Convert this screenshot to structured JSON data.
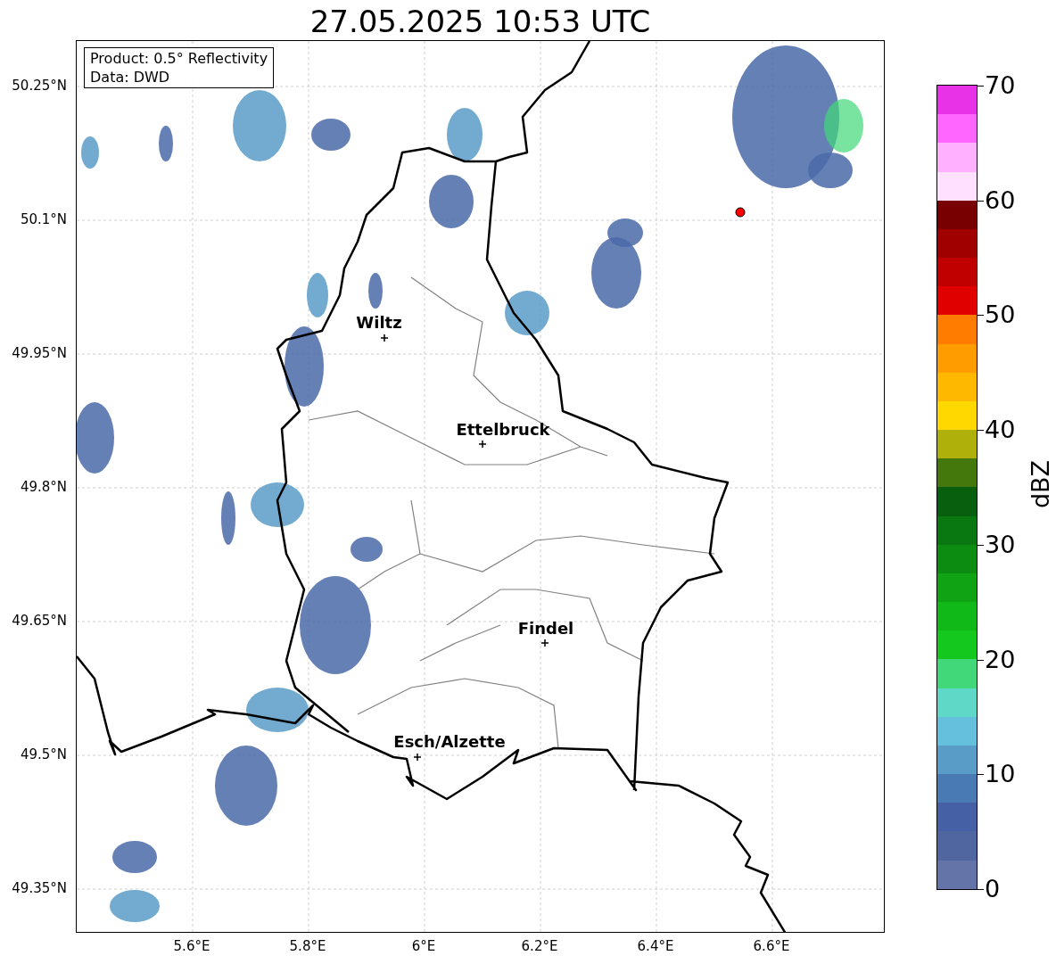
{
  "title": "27.05.2025 10:53 UTC",
  "info_box": [
    "Product: 0.5° Reflectivity",
    "Data: DWD"
  ],
  "x_ticks": [
    "5.6°E",
    "5.8°E",
    "6°E",
    "6.2°E",
    "6.4°E",
    "6.6°E"
  ],
  "y_ticks": [
    "50.25°N",
    "50.1°N",
    "49.95°N",
    "49.8°N",
    "49.65°N",
    "49.5°N",
    "49.35°N"
  ],
  "cities": [
    {
      "name": "Wiltz"
    },
    {
      "name": "Ettelbruck"
    },
    {
      "name": "Findel"
    },
    {
      "name": "Esch/Alzette"
    }
  ],
  "colorbar": {
    "label": "dBZ",
    "ticks": [
      "70",
      "60",
      "50",
      "40",
      "30",
      "20",
      "10",
      "0"
    ],
    "bands": [
      {
        "color": "#e832e8"
      },
      {
        "color": "#ff66ff"
      },
      {
        "color": "#ffb0ff"
      },
      {
        "color": "#ffe0ff"
      },
      {
        "color": "#780000"
      },
      {
        "color": "#a00000"
      },
      {
        "color": "#c00000"
      },
      {
        "color": "#e00000"
      },
      {
        "color": "#ff7c00"
      },
      {
        "color": "#ff9c00"
      },
      {
        "color": "#ffb800"
      },
      {
        "color": "#ffd800"
      },
      {
        "color": "#b0b00a"
      },
      {
        "color": "#44780c"
      },
      {
        "color": "#08600e"
      },
      {
        "color": "#0a7810"
      },
      {
        "color": "#0c8c10"
      },
      {
        "color": "#10a414"
      },
      {
        "color": "#10b818"
      },
      {
        "color": "#14c81e"
      },
      {
        "color": "#40d878"
      },
      {
        "color": "#60d8c8"
      },
      {
        "color": "#64c0dc"
      },
      {
        "color": "#5a9cc8"
      },
      {
        "color": "#4a7ab4"
      },
      {
        "color": "#4560a4"
      },
      {
        "color": "#5066a0"
      },
      {
        "color": "#6474a8"
      }
    ]
  }
}
